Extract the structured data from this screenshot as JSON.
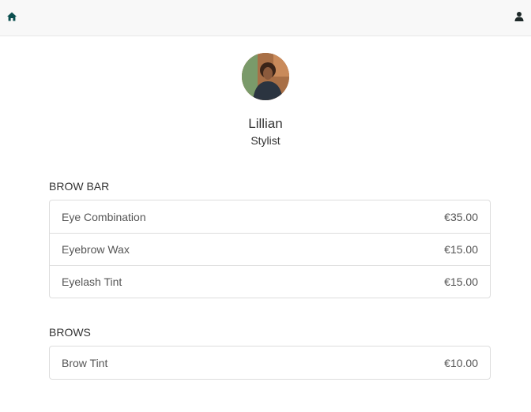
{
  "header": {
    "home_icon": "home-icon",
    "user_icon": "user-icon"
  },
  "profile": {
    "name": "Lillian",
    "role": "Stylist"
  },
  "sections": [
    {
      "title": "BROW BAR",
      "items": [
        {
          "name": "Eye Combination",
          "price": "€35.00"
        },
        {
          "name": "Eyebrow Wax",
          "price": "€15.00"
        },
        {
          "name": "Eyelash Tint",
          "price": "€15.00"
        }
      ]
    },
    {
      "title": "BROWS",
      "items": [
        {
          "name": "Brow Tint",
          "price": "€10.00"
        }
      ]
    }
  ]
}
